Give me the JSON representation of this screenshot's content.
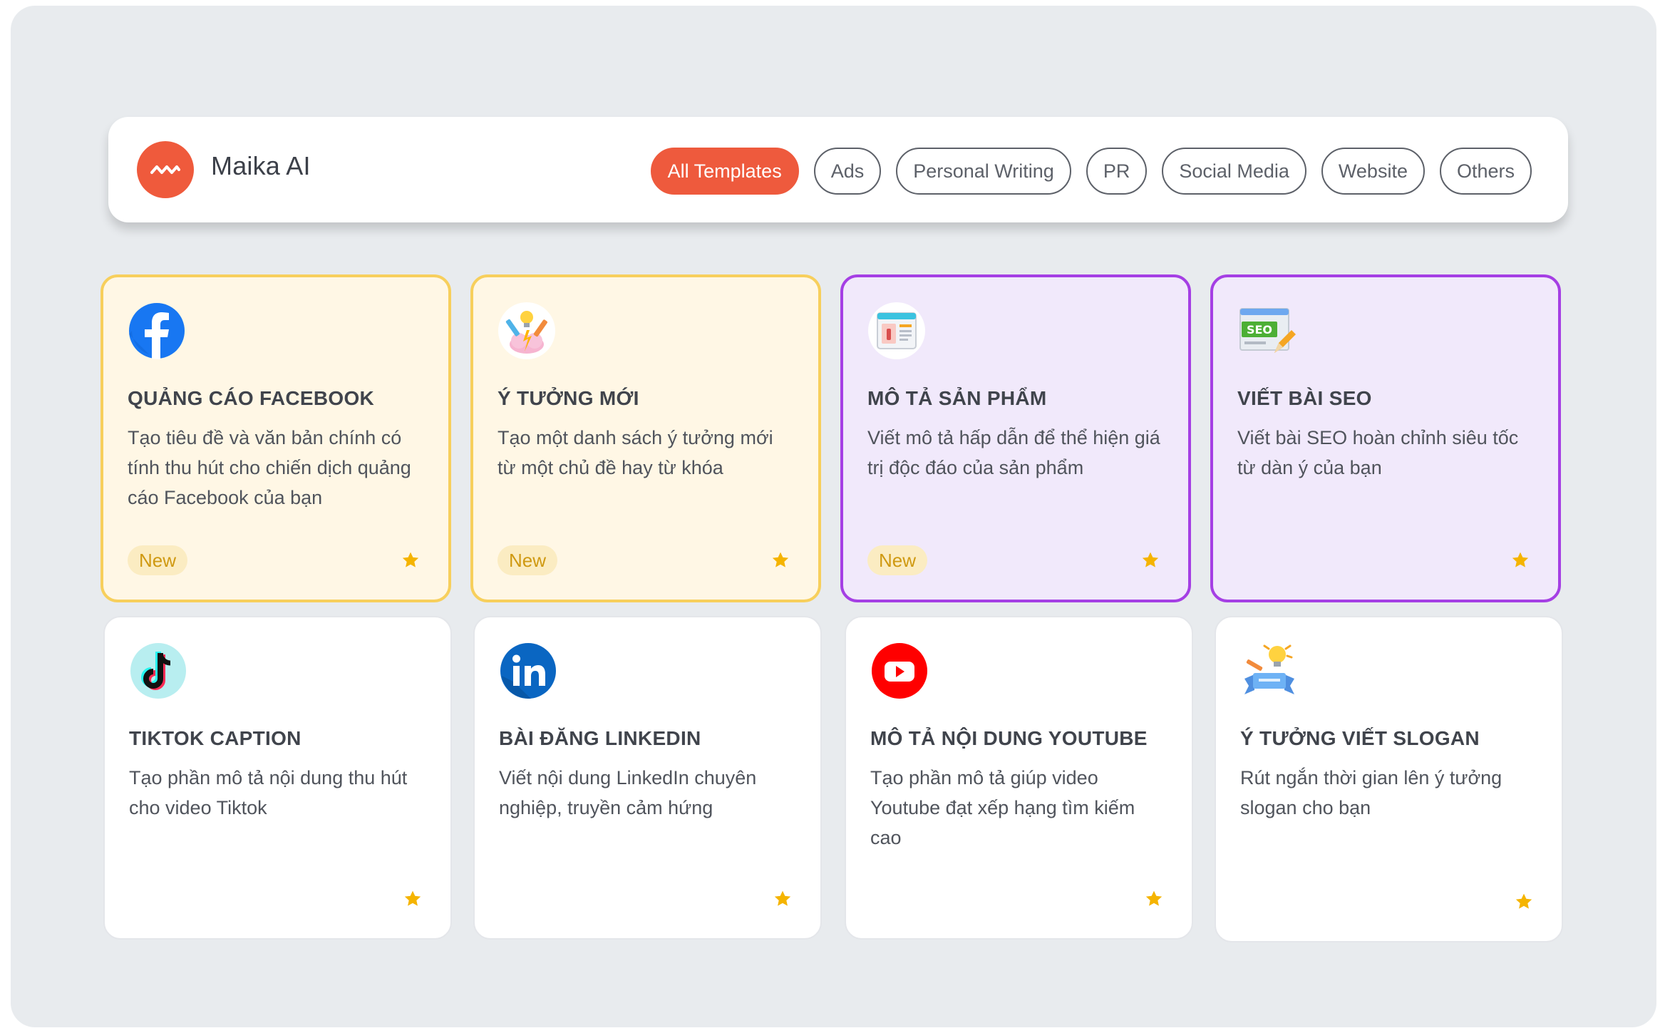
{
  "brand": {
    "name": "Maika AI"
  },
  "tabs": [
    {
      "label": "All Templates",
      "active": true
    },
    {
      "label": "Ads"
    },
    {
      "label": "Personal Writing"
    },
    {
      "label": "PR"
    },
    {
      "label": "Social Media"
    },
    {
      "label": "Website"
    },
    {
      "label": "Others"
    }
  ],
  "cards": [
    {
      "icon": "facebook-icon",
      "title": "QUẢNG CÁO FACEBOOK",
      "description": "Tạo tiêu đề và văn bản chính có tính thu hút cho chiến dịch quảng cáo Facebook của bạn",
      "badge": "New"
    },
    {
      "icon": "idea-icon",
      "title": "Ý TƯỞNG MỚI",
      "description": "Tạo một danh sách ý tưởng mới từ một chủ đề hay từ khóa",
      "badge": "New"
    },
    {
      "icon": "product-page-icon",
      "title": "MÔ TẢ SẢN PHẨM",
      "description": "Viết mô tả hấp dẫn để thể hiện giá trị độc đáo của sản phẩm",
      "badge": "New"
    },
    {
      "icon": "seo-icon",
      "title": "VIẾT BÀI SEO",
      "description": "Viết bài SEO hoàn chỉnh siêu tốc từ dàn ý của bạn"
    },
    {
      "icon": "tiktok-icon",
      "title": "TIKTOK CAPTION",
      "description": "Tạo phần mô tả nội dung thu hút cho video Tiktok"
    },
    {
      "icon": "linkedin-icon",
      "title": "BÀI ĐĂNG LINKEDIN",
      "description": "Viết nội dung LinkedIn chuyên nghiệp, truyền cảm hứng"
    },
    {
      "icon": "youtube-icon",
      "title": "MÔ TẢ NỘI DUNG YOUTUBE",
      "description": "Tạo phần mô tả giúp video Youtube đạt xếp hạng tìm kiếm cao"
    },
    {
      "icon": "slogan-idea-icon",
      "title": "Ý TƯỞNG VIẾT SLOGAN",
      "description": "Rút ngắn thời gian lên ý tưởng slogan cho bạn"
    }
  ],
  "colors": {
    "accent": "#ee5a3d",
    "highlight_yellow_border": "#f7cf5c",
    "highlight_purple_border": "#a53fe4",
    "star": "#f5b400"
  }
}
